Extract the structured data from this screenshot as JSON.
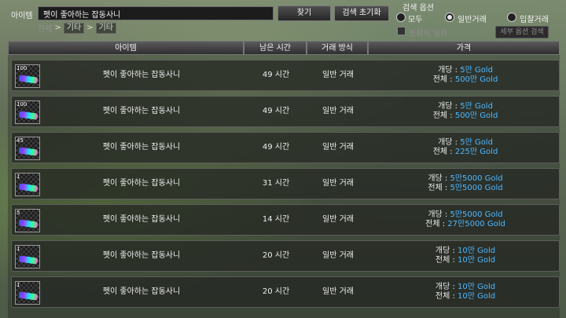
{
  "header": {
    "item_label": "아이템",
    "search_value": "펫이 좋아하는 잡동사니",
    "search_button": "찾기",
    "reset_button": "검색 초기화",
    "breadcrumb": [
      "전체",
      "기타",
      "기타"
    ],
    "options_title": "검색 옵션",
    "radio_options": [
      {
        "label": "모두",
        "selected": false
      },
      {
        "label": "일반거래",
        "selected": true
      },
      {
        "label": "입찰거래",
        "selected": false
      }
    ],
    "exact_match_label": "정확히 일치",
    "detail_options_button": "세부 옵션 검색"
  },
  "columns": [
    "아이템",
    "남은 시간",
    "거래 방식",
    "가격"
  ],
  "price_labels": {
    "unit": "개당 :",
    "total": "전체 :"
  },
  "listings": [
    {
      "qty": "100",
      "name": "펫이 좋아하는 잡동사니",
      "time": "49 시간",
      "method": "일반 거래",
      "unit_price": "5만 Gold",
      "total_price": "500만 Gold"
    },
    {
      "qty": "100",
      "name": "펫이 좋아하는 잡동사니",
      "time": "49 시간",
      "method": "일반 거래",
      "unit_price": "5만 Gold",
      "total_price": "500만 Gold"
    },
    {
      "qty": "45",
      "name": "펫이 좋아하는 잡동사니",
      "time": "49 시간",
      "method": "일반 거래",
      "unit_price": "5만 Gold",
      "total_price": "225만 Gold"
    },
    {
      "qty": "1",
      "name": "펫이 좋아하는 잡동사니",
      "time": "31 시간",
      "method": "일반 거래",
      "unit_price": "5만5000 Gold",
      "total_price": "5만5000 Gold"
    },
    {
      "qty": "5",
      "name": "펫이 좋아하는 잡동사니",
      "time": "14 시간",
      "method": "일반 거래",
      "unit_price": "5만5000 Gold",
      "total_price": "27만5000 Gold"
    },
    {
      "qty": "1",
      "name": "펫이 좋아하는 잡동사니",
      "time": "20 시간",
      "method": "일반 거래",
      "unit_price": "10만 Gold",
      "total_price": "10만 Gold"
    },
    {
      "qty": "1",
      "name": "펫이 좋아하는 잡동사니",
      "time": "20 시간",
      "method": "일반 거래",
      "unit_price": "10만 Gold",
      "total_price": "10만 Gold"
    }
  ],
  "colors": {
    "gold_text": "#4fb8ff"
  }
}
